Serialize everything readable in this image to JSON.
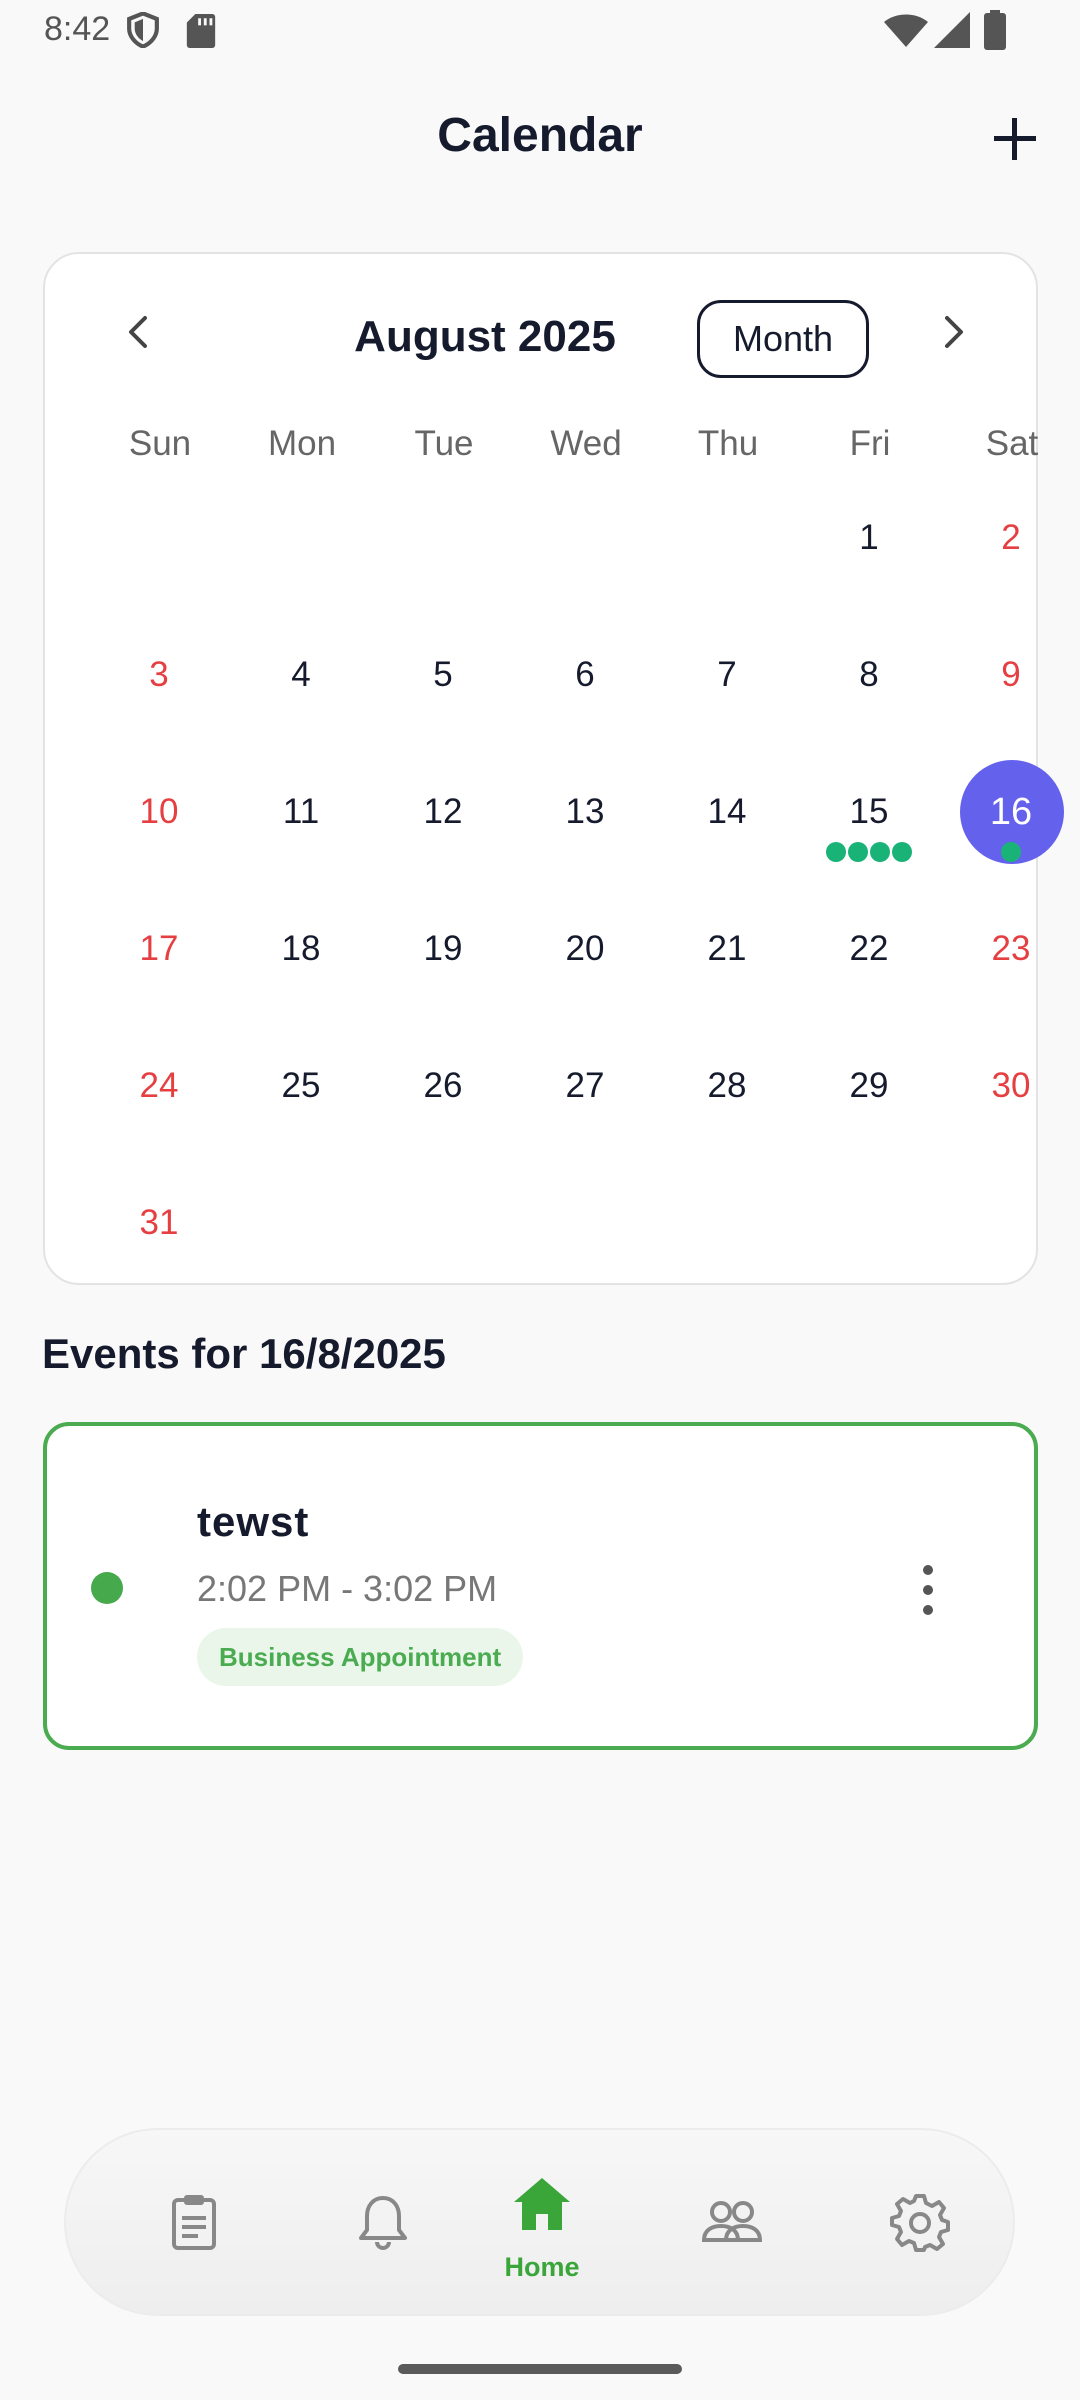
{
  "status_bar": {
    "time": "8:42"
  },
  "header": {
    "title": "Calendar"
  },
  "calendar": {
    "month_label": "August 2025",
    "view_toggle_label": "Month",
    "weekdays": [
      "Sun",
      "Mon",
      "Tue",
      "Wed",
      "Thu",
      "Fri",
      "Sat"
    ],
    "days": [
      "1",
      "2",
      "3",
      "4",
      "5",
      "6",
      "7",
      "8",
      "9",
      "10",
      "11",
      "12",
      "13",
      "14",
      "15",
      "16",
      "17",
      "18",
      "19",
      "20",
      "21",
      "22",
      "23",
      "24",
      "25",
      "26",
      "27",
      "28",
      "29",
      "30",
      "31"
    ],
    "selected_day": "16",
    "event_dot_counts": {
      "15": 4,
      "16": 1
    },
    "colors": {
      "selected": "#6462ec",
      "weekend": "#e53f42",
      "event_dot": "#1ab377"
    }
  },
  "events": {
    "heading": "Events for 16/8/2025",
    "items": [
      {
        "title": "tewst",
        "time": "2:02 PM - 3:02 PM",
        "category": "Business Appointment",
        "color": "#4aab50"
      }
    ]
  },
  "bottom_nav": {
    "items": [
      {
        "icon": "clipboard-icon",
        "label": ""
      },
      {
        "icon": "bell-icon",
        "label": ""
      },
      {
        "icon": "home-icon",
        "label": "Home",
        "active": true
      },
      {
        "icon": "people-icon",
        "label": ""
      },
      {
        "icon": "gear-icon",
        "label": ""
      }
    ],
    "accent": "#3aa63a"
  }
}
